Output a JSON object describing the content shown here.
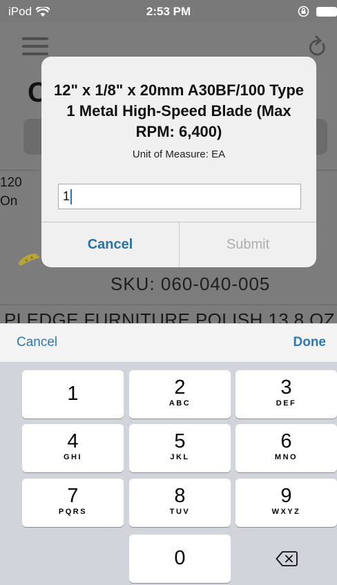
{
  "status_bar": {
    "carrier": "iPod",
    "time": "2:53 PM"
  },
  "background": {
    "title_partial": "C",
    "list_line1": "120",
    "list_line2": "On",
    "sku_partial": "SKU: 060-040-005",
    "next_item": "PLEDGE FURNITURE POLISH 13.8 OZ"
  },
  "modal": {
    "title": "12\" x 1/8\" x 20mm A30BF/100 Type 1 Metal High-Speed Blade (Max RPM: 6,400)",
    "unit_of_measure": "Unit of Measure: EA",
    "quantity_value": "1",
    "cancel_label": "Cancel",
    "submit_label": "Submit"
  },
  "keyboard_toolbar": {
    "cancel_label": "Cancel",
    "done_label": "Done"
  },
  "keypad": {
    "keys": [
      {
        "num": "1",
        "letters": ""
      },
      {
        "num": "2",
        "letters": "ABC"
      },
      {
        "num": "3",
        "letters": "DEF"
      },
      {
        "num": "4",
        "letters": "GHI"
      },
      {
        "num": "5",
        "letters": "JKL"
      },
      {
        "num": "6",
        "letters": "MNO"
      },
      {
        "num": "7",
        "letters": "PQRS"
      },
      {
        "num": "8",
        "letters": "TUV"
      },
      {
        "num": "9",
        "letters": "WXYZ"
      },
      {
        "num": "0",
        "letters": ""
      }
    ]
  },
  "colors": {
    "accent_blue": "#2c79b6",
    "modal_background": "#f0f0f0",
    "keypad_background": "#d1d4da"
  }
}
